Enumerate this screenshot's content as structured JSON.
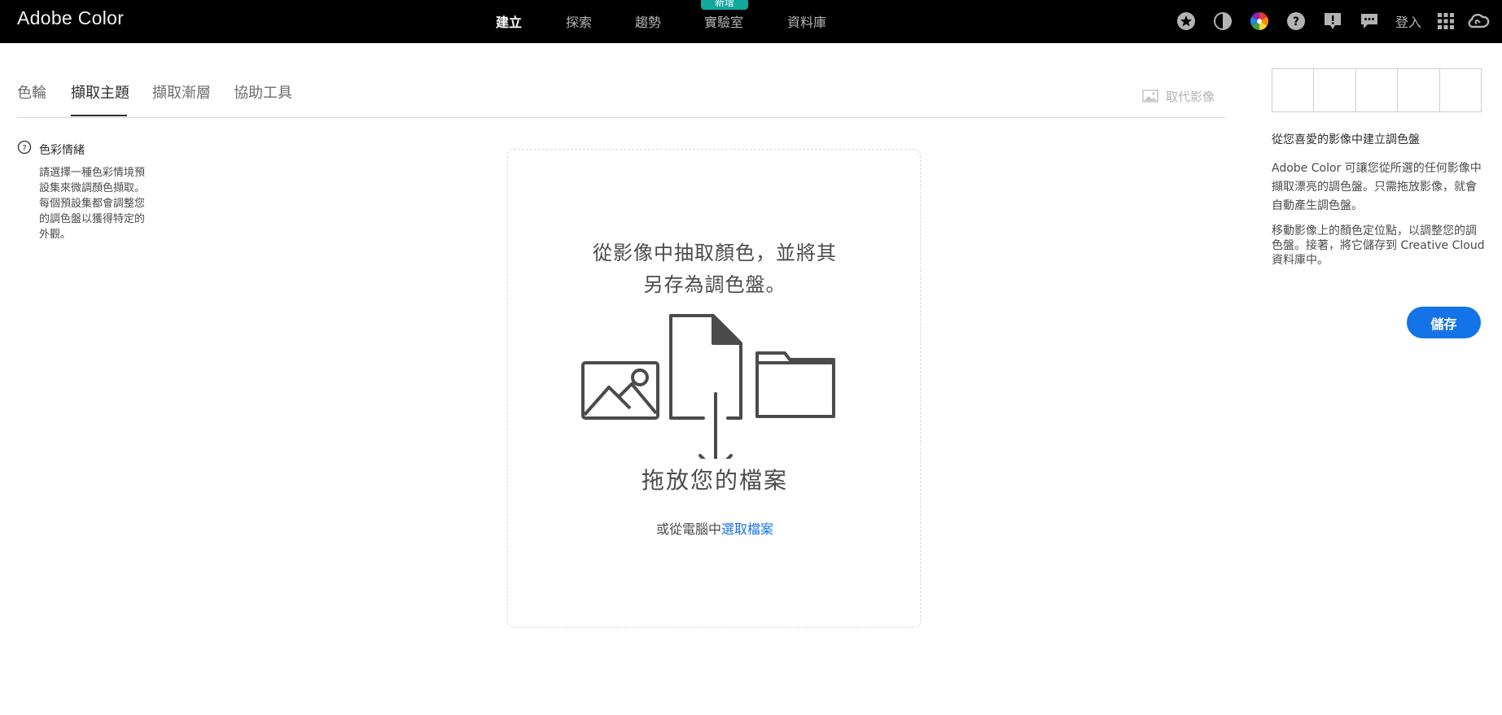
{
  "app": {
    "title": "Adobe Color"
  },
  "nav": {
    "items": [
      {
        "label": "建立"
      },
      {
        "label": "探索"
      },
      {
        "label": "趨勢"
      },
      {
        "label": "實驗室"
      },
      {
        "label": "資料庫"
      }
    ],
    "active": "建立",
    "badge": "新增",
    "login": "登入"
  },
  "icons": [
    "star-icon",
    "contrast-icon",
    "color-wheel-icon",
    "help-icon",
    "feedback-alert-icon",
    "chat-icon",
    "apps-grid-icon",
    "creative-cloud-icon"
  ],
  "tabs": {
    "items": [
      {
        "label": "色輪"
      },
      {
        "label": "擷取主題"
      },
      {
        "label": "擷取漸層"
      },
      {
        "label": "協助工具"
      }
    ],
    "active": "擷取主題",
    "replace_image": "取代影像"
  },
  "mood": {
    "title": "色彩情緒",
    "description": "請選擇一種色彩情境預設集來微調顏色擷取。每個預設集都會調整您的調色盤以獲得特定的外觀。"
  },
  "dropzone": {
    "heading": "從影像中抽取顏色，並將其另存為調色盤。",
    "label": "拖放您的檔案",
    "sub_prefix": "或從電腦中",
    "sub_link": "選取檔案"
  },
  "panel": {
    "title": "從您喜愛的影像中建立調色盤",
    "p1": "Adobe Color 可讓您從所選的任何影像中擷取漂亮的調色盤。只需拖放影像，就會自動產生調色盤。",
    "p2": "移動影像上的顏色定位點，以調整您的調色盤。接著，將它儲存到 Creative Cloud 資料庫中。",
    "save": "儲存"
  },
  "colors": {
    "accent": "#1473e6",
    "badge": "#13a89e",
    "topbar": "#000000"
  }
}
